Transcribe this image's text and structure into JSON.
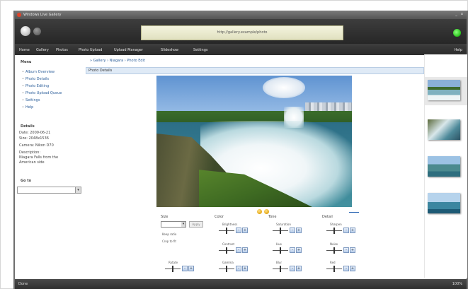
{
  "window": {
    "title": "Windows Live Gallery",
    "min": "_",
    "close": "x"
  },
  "toolbar": {
    "address_text": "http://gallery.example/photo"
  },
  "menubar": {
    "items": [
      "Home",
      "Gallery",
      "Photos",
      "Photo Upload",
      "Upload Manager",
      "Slideshow",
      "Settings"
    ],
    "right_item": "Help"
  },
  "sidebar": {
    "section_title": "Menu",
    "links": [
      "Album Overview",
      "Photo Details",
      "Photo Editing",
      "Photo Upload Queue",
      "Settings",
      "Help"
    ],
    "details_title": "Details",
    "fields": [
      "Date: 2009-06-21",
      "Size: 2048x1536",
      "Camera: Nikon D70",
      "Description:",
      "Niagara Falls from the",
      "American side"
    ],
    "search_title": "Go to",
    "select_btn": "▾"
  },
  "main": {
    "breadcrumb": "» Gallery › Niagara › Photo Edit",
    "title": "Photo Details",
    "scale_label": "100%"
  },
  "controls": {
    "panels": [
      {
        "title": "Size",
        "dropdown": "▾",
        "apply": "Apply",
        "check1": "Keep ratio",
        "check2": "Crop to fit",
        "bottom_slider": "Rotate"
      },
      {
        "title": "Color",
        "sliders": [
          "Brightness",
          "Contrast",
          "Gamma"
        ]
      },
      {
        "title": "Tone",
        "sliders": [
          "Saturation",
          "Hue",
          "Blur"
        ]
      },
      {
        "title": "Detail",
        "sliders": [
          "Sharpen",
          "Noise",
          "Red"
        ]
      }
    ],
    "button_minus": "-",
    "button_plus": "+"
  },
  "statusbar": {
    "left": "Done",
    "right": "100%"
  }
}
